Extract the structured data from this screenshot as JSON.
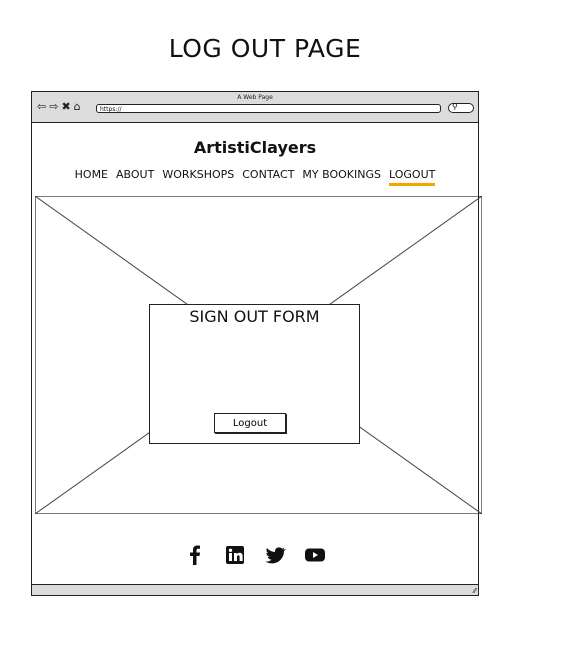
{
  "page_heading": "LOG OUT PAGE",
  "browser": {
    "window_title": "A Web Page",
    "url": "https://",
    "nav_icons": [
      "back-icon",
      "forward-icon",
      "close-icon",
      "home-icon"
    ],
    "search_icon": "search-icon"
  },
  "site": {
    "title": "ArtistiClayers",
    "nav": [
      {
        "label": "HOME",
        "active": false
      },
      {
        "label": "ABOUT",
        "active": false
      },
      {
        "label": "WORKSHOPS",
        "active": false
      },
      {
        "label": "CONTACT",
        "active": false
      },
      {
        "label": "MY BOOKINGS",
        "active": false
      },
      {
        "label": "LOGOUT",
        "active": true
      }
    ],
    "accent_color": "#f0a500"
  },
  "form": {
    "title": "SIGN OUT FORM",
    "button_label": "Logout"
  },
  "footer": {
    "icons": [
      "facebook-icon",
      "linkedin-icon",
      "twitter-icon",
      "youtube-icon"
    ]
  }
}
